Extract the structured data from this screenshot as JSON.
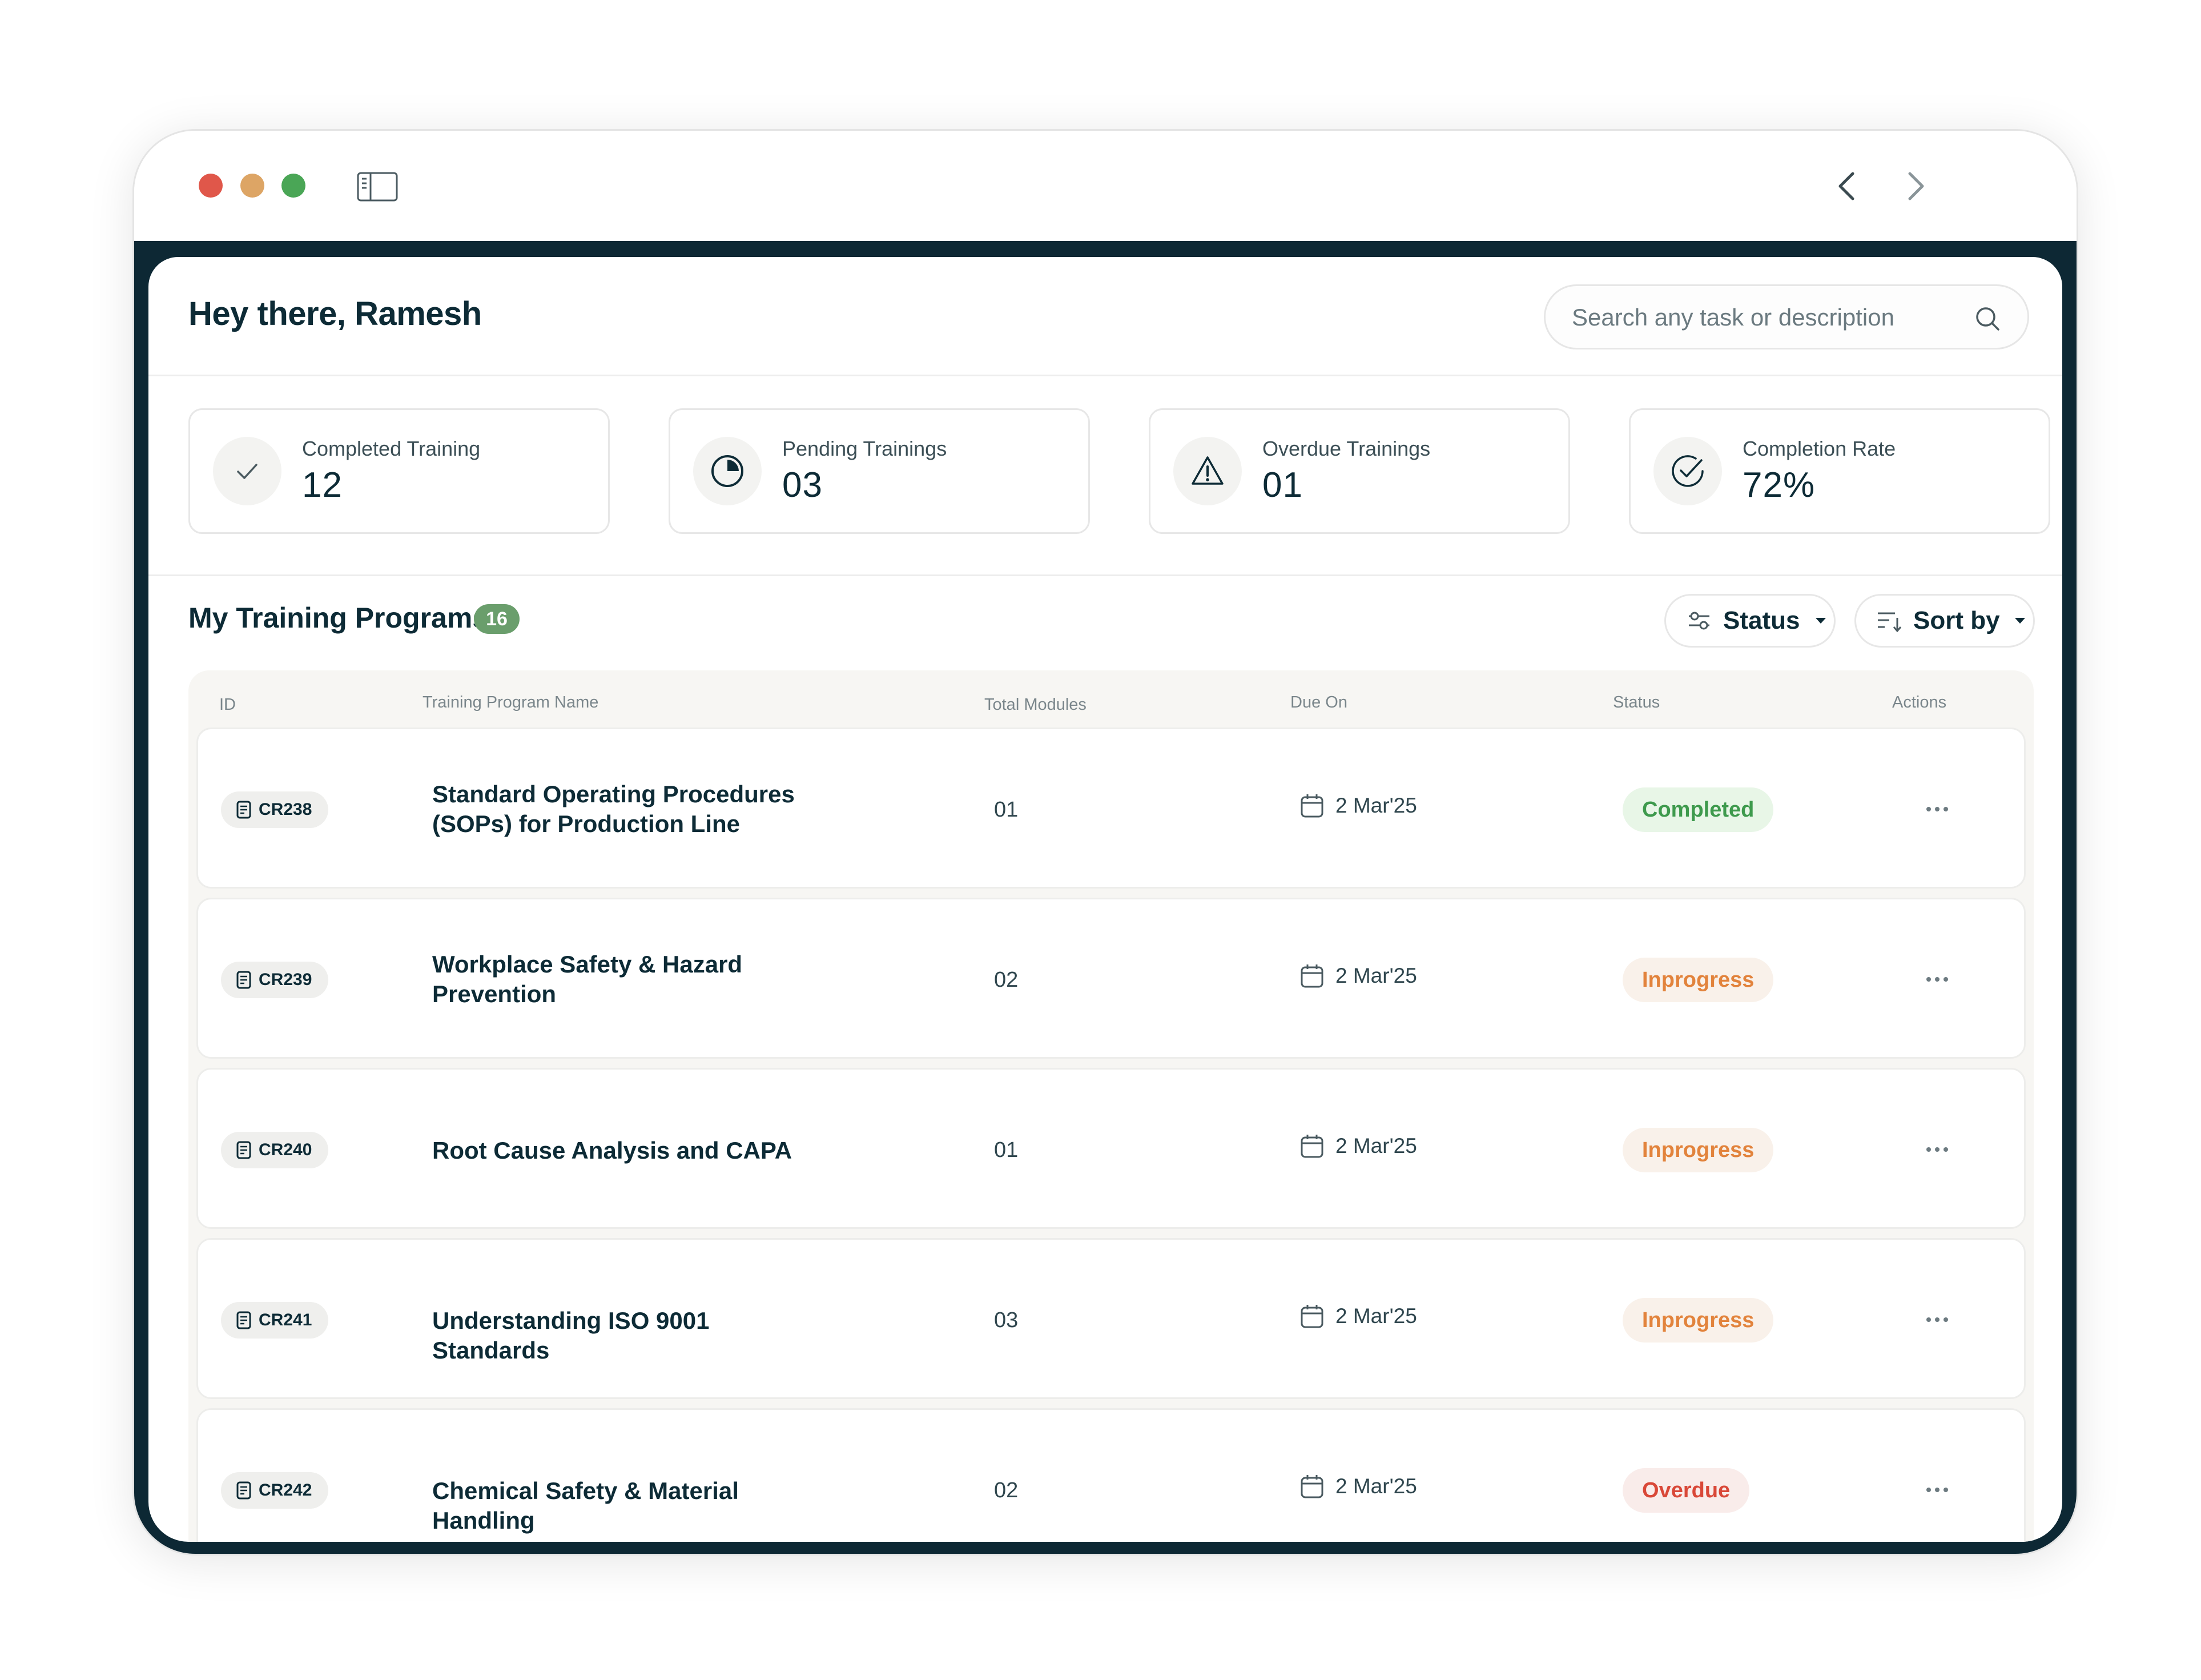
{
  "header": {
    "greeting": "Hey there, Ramesh",
    "search_placeholder": "Search any task or description"
  },
  "stats": [
    {
      "label": "Completed Training",
      "value": "12",
      "icon": "check-icon"
    },
    {
      "label": "Pending Trainings",
      "value": "03",
      "icon": "pie-clock-icon"
    },
    {
      "label": "Overdue Trainings",
      "value": "01",
      "icon": "warning-icon"
    },
    {
      "label": "Completion Rate",
      "value": "72%",
      "icon": "check-circle-icon"
    }
  ],
  "programs": {
    "title": "My Training Programs",
    "count": "16",
    "filters": {
      "status_label": "Status",
      "sort_label": "Sort by"
    },
    "columns": [
      "ID",
      "Training Program Name",
      "Total Modules",
      "Due On",
      "Status",
      "Actions"
    ],
    "rows": [
      {
        "id": "CR238",
        "name": "Standard Operating Procedures (SOPs) for Production Line",
        "modules": "01",
        "due": "2 Mar'25",
        "status": "Completed"
      },
      {
        "id": "CR239",
        "name": "Workplace Safety & Hazard Prevention",
        "modules": "02",
        "due": "2 Mar'25",
        "status": "Inprogress"
      },
      {
        "id": "CR240",
        "name": "Root Cause Analysis and CAPA",
        "modules": "01",
        "due": "2 Mar'25",
        "status": "Inprogress"
      },
      {
        "id": "CR241",
        "name": "Understanding ISO 9001 Standards",
        "modules": "03",
        "due": "2 Mar'25",
        "status": "Inprogress"
      },
      {
        "id": "CR242",
        "name": "Chemical Safety & Material Handling",
        "modules": "02",
        "due": "2 Mar'25",
        "status": "Overdue"
      }
    ]
  },
  "colors": {
    "frame": "#0d2834",
    "completed": "#3e9a4d",
    "inprogress": "#e2833c",
    "overdue": "#d94838",
    "badge": "#6a9e6c"
  }
}
